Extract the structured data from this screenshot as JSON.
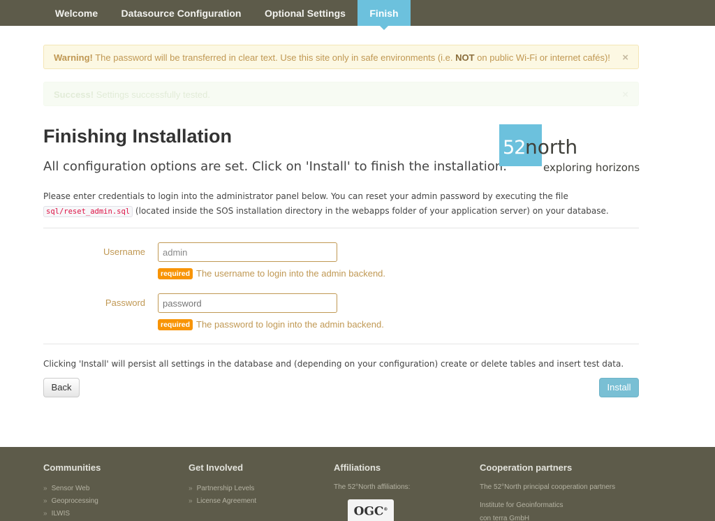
{
  "nav": {
    "tabs": [
      {
        "label": "Welcome"
      },
      {
        "label": "Datasource Configuration"
      },
      {
        "label": "Optional Settings"
      },
      {
        "label": "Finish",
        "active": true
      }
    ]
  },
  "alerts": {
    "warning": {
      "strong": "Warning!",
      "text_before": " The password will be transferred in clear text. Use this site only in safe environments (i.e. ",
      "emphasis": "NOT",
      "text_after": " on public Wi-Fi or internet cafés)!",
      "close": "×"
    },
    "success": {
      "strong": "Success!",
      "text": " Settings successfully tested.",
      "close": "×"
    }
  },
  "header": {
    "title": "Finishing Installation",
    "subtitle": "All configuration options are set. Click on 'Install' to finish the installation."
  },
  "logo": {
    "number": "52",
    "name": "north",
    "tagline": "exploring horizons"
  },
  "intro": {
    "text_before": "Please enter credentials to login into the administrator panel below. You can reset your admin password by executing the file ",
    "code": "sql/reset_admin.sql",
    "text_after": " (located inside the SOS installation directory in the webapps folder of your application server) on your database."
  },
  "form": {
    "username": {
      "label": "Username",
      "value": "admin",
      "placeholder": "admin",
      "badge": "required",
      "help": "The username to login into the admin backend."
    },
    "password": {
      "label": "Password",
      "value": "",
      "placeholder": "password",
      "badge": "required",
      "help": "The password to login into the admin backend."
    }
  },
  "note": "Clicking 'Install' will persist all settings in the database and (depending on your configuration) create or delete tables and insert test data.",
  "buttons": {
    "back": "Back",
    "install": "Install"
  },
  "footer": {
    "communities": {
      "title": "Communities",
      "links": [
        "Sensor Web",
        "Geoprocessing",
        "ILWIS"
      ]
    },
    "get_involved": {
      "title": "Get Involved",
      "links": [
        "Partnership Levels",
        "License Agreement"
      ]
    },
    "affiliations": {
      "title": "Affiliations",
      "text": "The 52°North affiliations:",
      "ogc_logo": "OGC"
    },
    "cooperation": {
      "title": "Cooperation partners",
      "text": "The 52°North principal cooperation partners",
      "partners": [
        "Institute for Geoinformatics",
        "con terra GmbH"
      ]
    }
  },
  "colors": {
    "nav_bg": "#5d5b4a",
    "accent": "#6cc1dd",
    "warning_text": "#c09853",
    "badge": "#f89406"
  },
  "icons": {
    "close": "close-icon",
    "chevron": "chevron-right-icon"
  }
}
